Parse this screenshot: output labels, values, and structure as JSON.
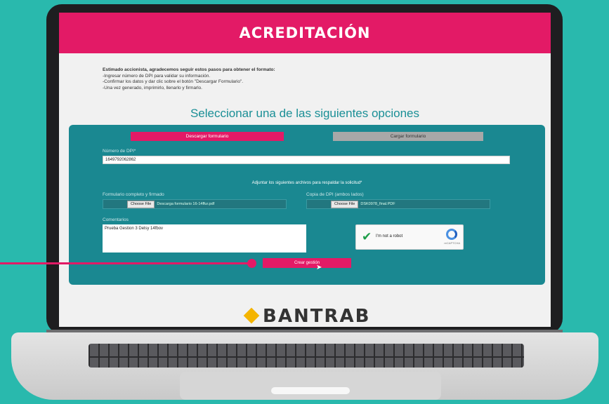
{
  "header": {
    "title": "ACREDITACIÓN"
  },
  "intro": {
    "lead": "Estimado accionista, agradecemos seguir estos pasos para obtener el formato:",
    "steps": [
      "-Ingresar número de DPI para validar su información.",
      "-Confirmar los datos y dar clic sobre el botón \"Descargar Formulario\".",
      "-Una vez generado, imprimirlo, llenarlo y firmarlo."
    ]
  },
  "section_heading": "Seleccionar una de las siguientes opciones",
  "tabs": {
    "download": "Descargar formulario",
    "upload": "Cargar formulario"
  },
  "dpi": {
    "label": "Número de DPI*",
    "value": "1649792062862"
  },
  "attach_note": "Adjuntar los siguientes archivos para respaldar la solicitud*",
  "files": {
    "form_label": "Formulario completo y firmado",
    "form_button": "Choose File",
    "form_file": "Descarga formulario 16-14ffur.pdf",
    "dpi_copy_label": "Copia de DPI (ambos lados)",
    "dpi_copy_button": "Choose File",
    "dpi_copy_file": "DSK0978_final.PDF"
  },
  "comments": {
    "label": "Comentarios",
    "value": "Prueba Gestion 3 Delsy 14fbov"
  },
  "captcha": {
    "label": "I'm not a robot",
    "brand": "reCAPTCHA"
  },
  "submit": {
    "label": "Crear gestión"
  },
  "brand": {
    "name": "BANTRAB"
  },
  "colors": {
    "accent": "#e31a66",
    "panel": "#1a8891",
    "background": "#29b9ad"
  }
}
